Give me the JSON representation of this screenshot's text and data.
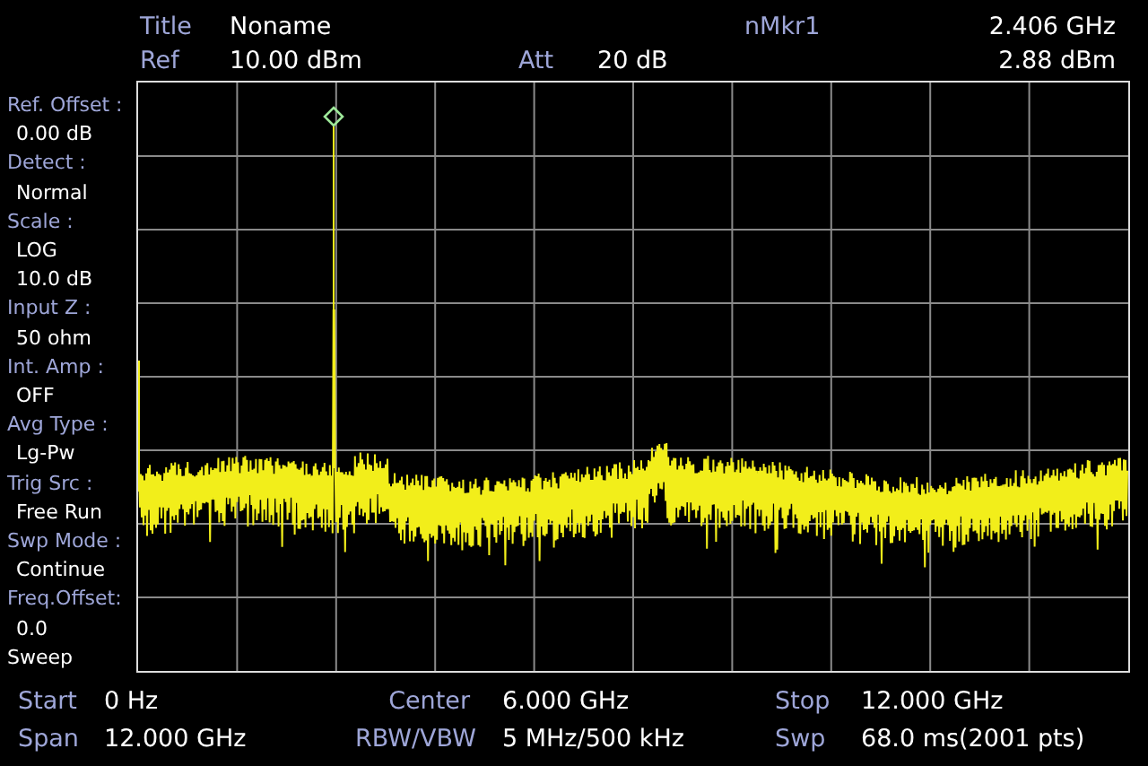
{
  "header": {
    "rows": [
      {
        "title_label": "Title",
        "title": "Noname",
        "marker_label": "nMkr1",
        "marker_frequency": "2.406 GHz"
      },
      {
        "ref_label": "Ref",
        "ref_value": "10.00 dBm",
        "att_label": "Att",
        "att_value": "20 dB",
        "marker_amplitude": "2.88 dBm"
      }
    ]
  },
  "sidebar": {
    "items": [
      {
        "kind": "setting",
        "label": "Ref. Offset :",
        "values": [
          "0.00 dB"
        ]
      },
      {
        "kind": "setting",
        "label": "Detect :",
        "values": [
          "Normal"
        ]
      },
      {
        "kind": "setting",
        "label": "Scale :",
        "values": [
          "LOG",
          "10.0 dB"
        ]
      },
      {
        "kind": "setting",
        "label": "Input Z :",
        "values": [
          "50 ohm"
        ]
      },
      {
        "kind": "setting",
        "label": "Int. Amp :",
        "values": [
          "OFF"
        ]
      },
      {
        "kind": "setting",
        "label": "Avg Type :",
        "values": [
          "Lg-Pw"
        ]
      },
      {
        "kind": "setting",
        "label": "Trig Src :",
        "values": [
          "Free Run"
        ]
      },
      {
        "kind": "setting",
        "label": "Swp Mode :",
        "values": [
          "Continue"
        ]
      },
      {
        "kind": "setting",
        "label": "Freq.Offset:",
        "values": [
          "0.0"
        ]
      },
      {
        "kind": "section",
        "label": "Sweep"
      }
    ]
  },
  "footer": {
    "rows": [
      [
        {
          "label": "Start",
          "value": "0 Hz"
        },
        {
          "label": "Center",
          "value": "6.000 GHz"
        },
        {
          "label": "Stop",
          "value": "12.000 GHz"
        }
      ],
      [
        {
          "label": "Span",
          "value": "12.000 GHz"
        },
        {
          "label": "RBW/VBW",
          "value": "5 MHz/500 kHz"
        },
        {
          "label": "Swp",
          "value": "68.0 ms(2001 pts)"
        }
      ]
    ]
  }
}
